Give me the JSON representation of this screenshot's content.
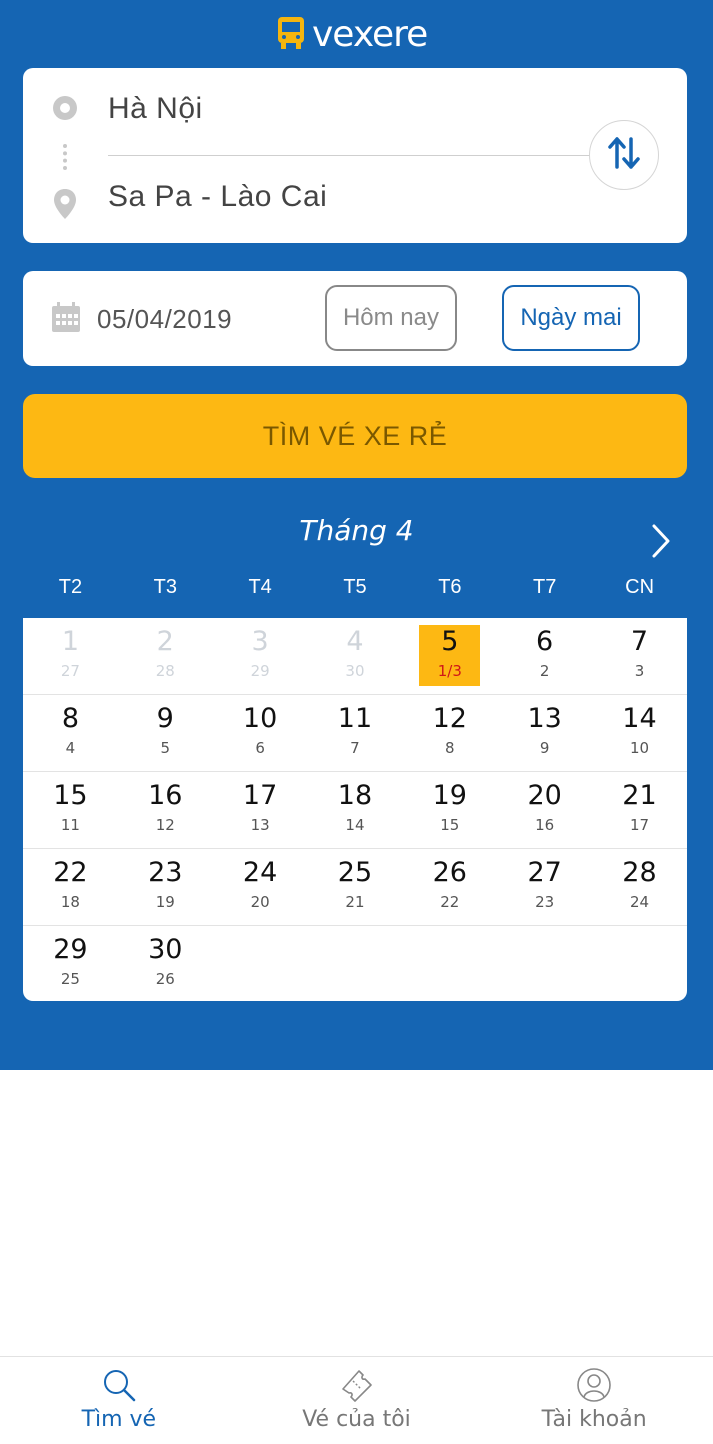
{
  "header": {
    "brand": "vexere",
    "logo_icon": "bus-icon"
  },
  "route": {
    "from": "Hà Nội",
    "to": "Sa Pa - Lào Cai",
    "from_icon": "origin-dot-icon",
    "to_icon": "location-pin-icon",
    "swap_icon": "swap-vertical-icon"
  },
  "date": {
    "value": "05/04/2019",
    "icon": "calendar-icon",
    "today_label": "Hôm nay",
    "tomorrow_label": "Ngày mai"
  },
  "search": {
    "label": "TÌM VÉ XE RẺ"
  },
  "calendar": {
    "month_title": "Tháng 4",
    "weekdays": [
      "T2",
      "T3",
      "T4",
      "T5",
      "T6",
      "T7",
      "CN"
    ],
    "weeks": [
      [
        {
          "d": "1",
          "l": "27",
          "state": "past"
        },
        {
          "d": "2",
          "l": "28",
          "state": "past"
        },
        {
          "d": "3",
          "l": "29",
          "state": "past"
        },
        {
          "d": "4",
          "l": "30",
          "state": "past"
        },
        {
          "d": "5",
          "l": "1/3",
          "state": "selected"
        },
        {
          "d": "6",
          "l": "2",
          "state": ""
        },
        {
          "d": "7",
          "l": "3",
          "state": ""
        }
      ],
      [
        {
          "d": "8",
          "l": "4",
          "state": ""
        },
        {
          "d": "9",
          "l": "5",
          "state": ""
        },
        {
          "d": "10",
          "l": "6",
          "state": ""
        },
        {
          "d": "11",
          "l": "7",
          "state": ""
        },
        {
          "d": "12",
          "l": "8",
          "state": ""
        },
        {
          "d": "13",
          "l": "9",
          "state": ""
        },
        {
          "d": "14",
          "l": "10",
          "state": ""
        }
      ],
      [
        {
          "d": "15",
          "l": "11",
          "state": ""
        },
        {
          "d": "16",
          "l": "12",
          "state": ""
        },
        {
          "d": "17",
          "l": "13",
          "state": ""
        },
        {
          "d": "18",
          "l": "14",
          "state": ""
        },
        {
          "d": "19",
          "l": "15",
          "state": ""
        },
        {
          "d": "20",
          "l": "16",
          "state": ""
        },
        {
          "d": "21",
          "l": "17",
          "state": ""
        }
      ],
      [
        {
          "d": "22",
          "l": "18",
          "state": ""
        },
        {
          "d": "23",
          "l": "19",
          "state": ""
        },
        {
          "d": "24",
          "l": "20",
          "state": ""
        },
        {
          "d": "25",
          "l": "21",
          "state": ""
        },
        {
          "d": "26",
          "l": "22",
          "state": ""
        },
        {
          "d": "27",
          "l": "23",
          "state": ""
        },
        {
          "d": "28",
          "l": "24",
          "state": ""
        }
      ],
      [
        {
          "d": "29",
          "l": "25",
          "state": ""
        },
        {
          "d": "30",
          "l": "26",
          "state": ""
        }
      ]
    ]
  },
  "nav": [
    {
      "label": "Tìm vé",
      "icon": "search-icon",
      "active": true
    },
    {
      "label": "Vé của tôi",
      "icon": "ticket-icon",
      "active": false
    },
    {
      "label": "Tài khoản",
      "icon": "account-icon",
      "active": false
    }
  ],
  "colors": {
    "primary": "#1565b3",
    "accent": "#fdb813",
    "lunar_highlight": "#d01818"
  }
}
